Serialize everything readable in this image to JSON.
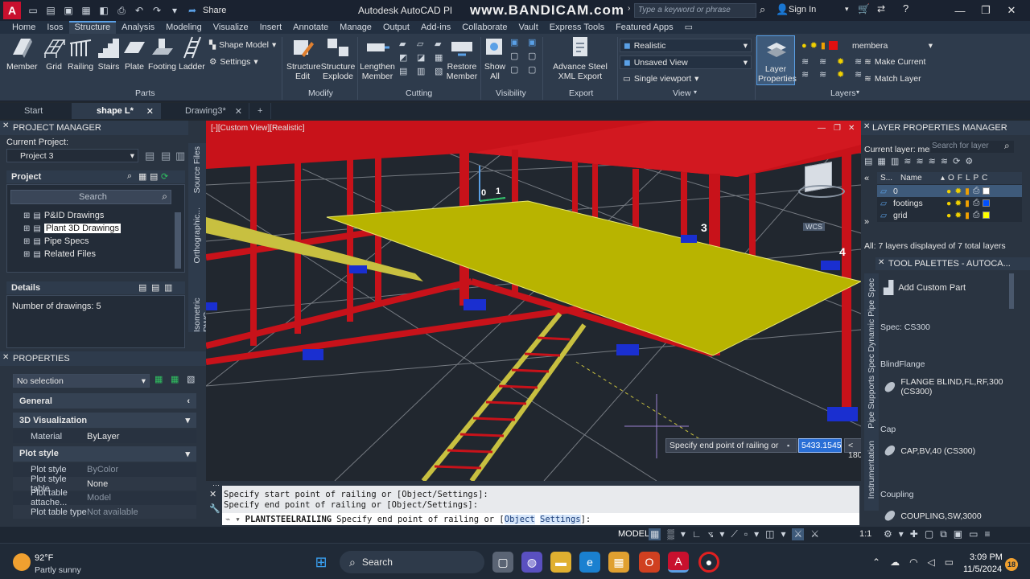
{
  "titlebar": {
    "app_title": "Autodesk AutoCAD Pl",
    "watermark": "www.BANDICAM.com",
    "share_label": "Share",
    "search_placeholder": "Type a keyword or phrase",
    "sign_in": "Sign In"
  },
  "ribbon_tabs": [
    "Home",
    "Isos",
    "Structure",
    "Analysis",
    "Modeling",
    "Visualize",
    "Insert",
    "Annotate",
    "Manage",
    "Output",
    "Add-ins",
    "Collaborate",
    "Vault",
    "Express Tools",
    "Featured Apps"
  ],
  "active_tab": "Structure",
  "ribbon": {
    "parts": {
      "member": "Member",
      "grid": "Grid",
      "railing": "Railing",
      "stairs": "Stairs",
      "plate": "Plate",
      "footing": "Footing",
      "ladder": "Ladder",
      "shape_model": "Shape Model",
      "settings": "Settings",
      "group": "Parts"
    },
    "modify": {
      "structure_edit": "Structure Edit",
      "structure_explode": "Structure Explode",
      "group": "Modify"
    },
    "cutting": {
      "lengthen_member": "Lengthen Member",
      "restore_member": "Restore Member",
      "group": "Cutting"
    },
    "visibility": {
      "show_all": "Show All",
      "group": "Visibility"
    },
    "export": {
      "advance_steel": "Advance Steel XML Export",
      "group": "Export"
    },
    "view": {
      "visual_style": "Realistic",
      "named_view": "Unsaved View",
      "viewport": "Single viewport",
      "group": "View"
    },
    "layers": {
      "layer_properties": "Layer Properties",
      "current_layer": "membera",
      "make_current": "Make Current",
      "match_layer": "Match Layer",
      "group": "Layers"
    }
  },
  "doc_tabs": [
    {
      "label": "Start",
      "active": false,
      "closable": false
    },
    {
      "label": "shape L*",
      "active": true,
      "closable": true
    },
    {
      "label": "Drawing3*",
      "active": false,
      "closable": true
    }
  ],
  "project_manager": {
    "title": "PROJECT MANAGER",
    "current_project_label": "Current Project:",
    "current_project": "Project 3",
    "project_label": "Project",
    "search_placeholder": "Search",
    "tree": [
      "P&ID Drawings",
      "Plant 3D Drawings",
      "Pipe Specs",
      "Related Files"
    ],
    "selected_tree_item": "Plant 3D Drawings",
    "details_label": "Details",
    "details_text": "Number of drawings: 5",
    "side_tabs": [
      "Source Files",
      "Orthographic...",
      "Isometric DWG"
    ]
  },
  "properties": {
    "title": "PROPERTIES",
    "selection": "No selection",
    "sections": [
      {
        "name": "General",
        "expanded": false,
        "rows": []
      },
      {
        "name": "3D Visualization",
        "expanded": true,
        "rows": [
          {
            "k": "Material",
            "v": "ByLayer",
            "dim": false
          }
        ]
      },
      {
        "name": "Plot style",
        "expanded": true,
        "rows": [
          {
            "k": "Plot style",
            "v": "ByColor",
            "dim": true
          },
          {
            "k": "Plot style table",
            "v": "None",
            "dim": false
          },
          {
            "k": "Plot table attache...",
            "v": "Model",
            "dim": true
          },
          {
            "k": "Plot table type",
            "v": "Not available",
            "dim": true
          }
        ]
      }
    ]
  },
  "viewport": {
    "label": "[-][Custom View][Realistic]",
    "marker_labels": [
      "0",
      "1",
      "3",
      "4"
    ],
    "viewcube_label": "WCS",
    "tooltip": "Specify end point of railing or",
    "dyn_input": "5433.1545",
    "dyn_angle": "< 180°"
  },
  "layer_manager": {
    "title": "LAYER PROPERTIES MANAGER",
    "current_layer_label": "Current layer: mer",
    "search_placeholder": "Search for layer",
    "col_status": "S...",
    "col_name": "Name",
    "layers": [
      {
        "name": "0",
        "color": "#ffffff"
      },
      {
        "name": "footings",
        "color": "#0050ff"
      },
      {
        "name": "grid",
        "color": "#ffff00"
      }
    ],
    "summary": "All: 7 layers displayed of 7 total layers"
  },
  "tool_palettes": {
    "title": "TOOL PALETTES - AUTOCA...",
    "add_custom_part": "Add Custom Part",
    "spec": "Spec: CS300",
    "items": [
      {
        "category": "BlindFlange",
        "name": "FLANGE BLIND,FL,RF,300 (CS300)"
      },
      {
        "category": "Cap",
        "name": "CAP,BV,40 (CS300)"
      },
      {
        "category": "Coupling",
        "name": "COUPLING,SW,3000"
      }
    ],
    "side_tabs": [
      "Dynamic Pipe Spec",
      "Pipe Supports Spec",
      "Instrumentation"
    ]
  },
  "command_line": {
    "history": [
      "Specify start point of railing or [Object/Settings]:",
      "Specify end point of railing or [Object/Settings]:"
    ],
    "command": "PLANTSTEELRAILING",
    "prompt": "Specify end point of railing or [",
    "opt1": "Object",
    "opt2": "Settings",
    "prompt_end": "]:"
  },
  "status_bar": {
    "model": "MODEL",
    "scale": "1:1"
  },
  "taskbar": {
    "weather_temp": "92°F",
    "weather_desc": "Partly sunny",
    "search": "Search",
    "time": "3:09 PM",
    "date": "11/5/2024",
    "notif_count": "18"
  },
  "colors": {
    "steel_red": "#d0101a",
    "plate_yellow": "#b8b400",
    "footing_blue": "#1a2fd0",
    "accent": "#5aa0e6"
  }
}
